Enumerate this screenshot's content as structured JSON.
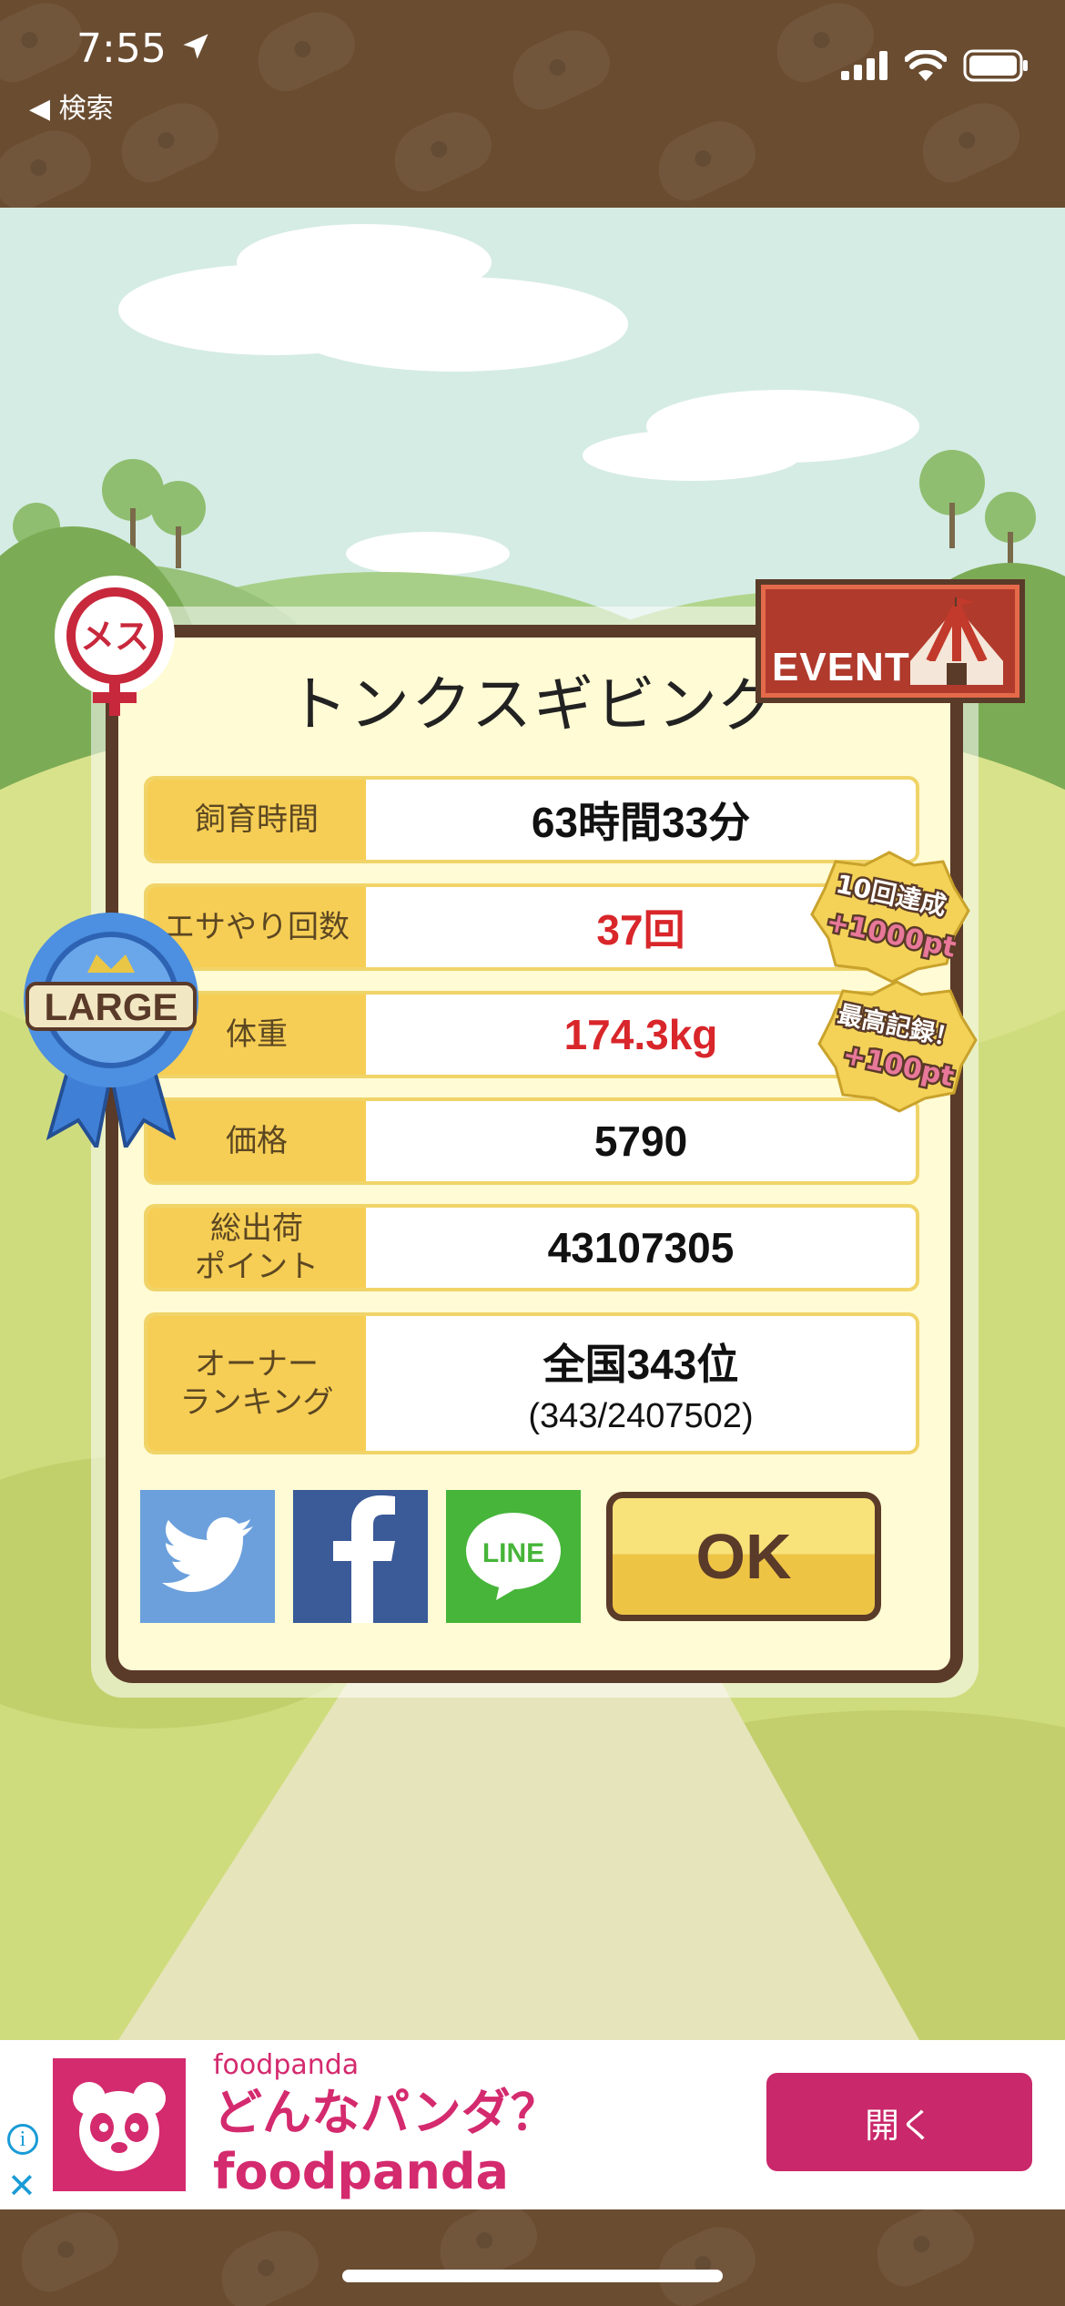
{
  "status_bar": {
    "time": "7:55",
    "back_label": "検索"
  },
  "game": {
    "pig_name": "トンクスギビング",
    "gender_badge": "メス",
    "size_ribbon": "LARGE",
    "event_badge": "EVENT",
    "stats": [
      {
        "label": "飼育時間",
        "value": "63時間33分"
      },
      {
        "label": "エサやり回数",
        "value": "37回"
      },
      {
        "label": "体重",
        "value": "174.3kg"
      },
      {
        "label": "価格",
        "value": "5790"
      },
      {
        "label": "総出荷\nポイント",
        "value": "43107305"
      },
      {
        "label": "オーナー\nランキング",
        "value": "全国343位",
        "sub": "(343/2407502)"
      }
    ],
    "bonus_badges": [
      {
        "line1": "10回達成",
        "line2": "+1000pt"
      },
      {
        "line1": "最高記録！",
        "line2": "+100pt"
      }
    ],
    "share_line_label": "LINE",
    "ok_label": "OK"
  },
  "ad": {
    "brand": "foodpanda",
    "headline_line1": "どんなパンダ？",
    "headline_line2": "foodpanda",
    "cta": "開く"
  },
  "colors": {
    "brand_pink": "#d42a6e",
    "label_yellow": "#f6ce55",
    "frame_brown": "#5a3a28",
    "value_red": "#d8262a"
  }
}
